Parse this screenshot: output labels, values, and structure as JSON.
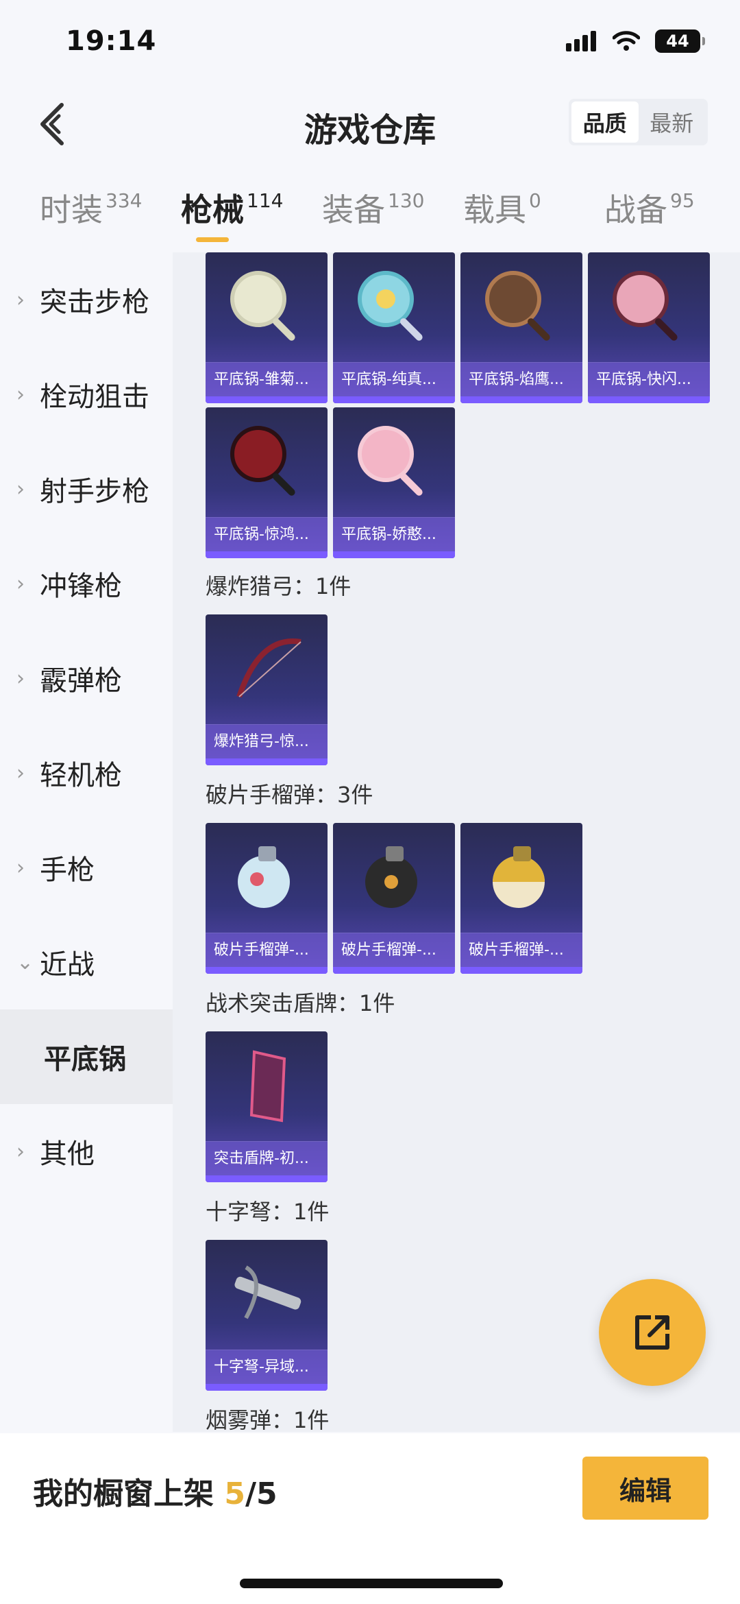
{
  "status_bar": {
    "time": "19:14",
    "battery": "44"
  },
  "header": {
    "title": "游戏仓库",
    "sort_options": [
      "品质",
      "最新"
    ]
  },
  "tabs": [
    {
      "label": "时装",
      "count": "334"
    },
    {
      "label": "枪械",
      "count": "114"
    },
    {
      "label": "装备",
      "count": "130"
    },
    {
      "label": "载具",
      "count": "0"
    },
    {
      "label": "战备",
      "count": "95"
    }
  ],
  "sidebar": {
    "items": [
      {
        "label": "突击步枪",
        "chevron": "›"
      },
      {
        "label": "栓动狙击",
        "chevron": "›"
      },
      {
        "label": "射手步枪",
        "chevron": "›"
      },
      {
        "label": "冲锋枪",
        "chevron": "›"
      },
      {
        "label": "霰弹枪",
        "chevron": "›"
      },
      {
        "label": "轻机枪",
        "chevron": "›"
      },
      {
        "label": "手枪",
        "chevron": "›"
      },
      {
        "label": "近战",
        "chevron": "⌄"
      },
      {
        "label": "平底锅",
        "chevron": ""
      },
      {
        "label": "其他",
        "chevron": "›"
      }
    ]
  },
  "groups": [
    {
      "title": "",
      "items": [
        {
          "label": "平底锅-雏菊...",
          "icon": "frying-pan-icon",
          "color": "#e8e8d0"
        },
        {
          "label": "平底锅-纯真...",
          "icon": "frying-pan-icon",
          "color": "#8ed6e3"
        },
        {
          "label": "平底锅-焰鹰...",
          "icon": "frying-pan-icon",
          "color": "#b07a50"
        },
        {
          "label": "平底锅-快闪...",
          "icon": "frying-pan-icon",
          "color": "#e9a6b8"
        },
        {
          "label": "平底锅-惊鸿...",
          "icon": "frying-pan-icon",
          "color": "#8a1d24"
        },
        {
          "label": "平底锅-娇憨...",
          "icon": "frying-pan-icon",
          "color": "#f3b5c6"
        }
      ]
    },
    {
      "title": "爆炸猎弓：1件",
      "items": [
        {
          "label": "爆炸猎弓-惊...",
          "icon": "bow-icon",
          "color": "#8b2230"
        }
      ]
    },
    {
      "title": "破片手榴弹：3件",
      "items": [
        {
          "label": "破片手榴弹-...",
          "icon": "grenade-icon",
          "color": "#cfe7f2"
        },
        {
          "label": "破片手榴弹-...",
          "icon": "grenade-icon",
          "color": "#2b2b2b"
        },
        {
          "label": "破片手榴弹-...",
          "icon": "grenade-icon",
          "color": "#f1e6c8"
        }
      ]
    },
    {
      "title": "战术突击盾牌：1件",
      "items": [
        {
          "label": "突击盾牌-初...",
          "icon": "shield-icon",
          "color": "#6b2a55"
        }
      ]
    },
    {
      "title": "十字弩：1件",
      "items": [
        {
          "label": "十字弩-异域...",
          "icon": "crossbow-icon",
          "color": "#bfc3c9"
        }
      ]
    },
    {
      "title": "烟雾弹：1件",
      "items": []
    }
  ],
  "bottom_bar": {
    "showcase_label": "我的橱窗上架 ",
    "showcase_current": "5",
    "showcase_total": "/5",
    "edit_label": "编辑"
  }
}
